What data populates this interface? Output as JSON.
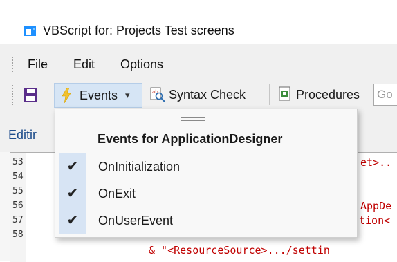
{
  "window": {
    "title": "VBScript for: Projects Test screens",
    "icon": "app-window-icon"
  },
  "menu": {
    "items": [
      "File",
      "Edit",
      "Options"
    ]
  },
  "toolbar": {
    "save_icon": "save-icon",
    "events_label": "Events",
    "events_arrow": "▾",
    "syntax_check_label": "Syntax Check",
    "procedures_label": "Procedures",
    "goto_placeholder": "Go"
  },
  "tab": {
    "label": "Editir"
  },
  "editor": {
    "line_numbers": [
      "53",
      "54",
      "55",
      "56",
      "57",
      "58"
    ],
    "visible_fragments": {
      "line53": "et>..",
      "line56": "AppDe",
      "line57": "tion<",
      "line58": "& \"<ResourceSource>.../settin"
    }
  },
  "events_menu": {
    "header": "Events for ApplicationDesigner",
    "items": [
      {
        "label": "OnInitialization",
        "checked": true
      },
      {
        "label": "OnExit",
        "checked": true
      },
      {
        "label": "OnUserEvent",
        "checked": true
      }
    ],
    "check_glyph": "✔"
  },
  "colors": {
    "accent": "#1e90ff",
    "check_bg": "#d7e4f4",
    "code_string": "#c00000"
  }
}
